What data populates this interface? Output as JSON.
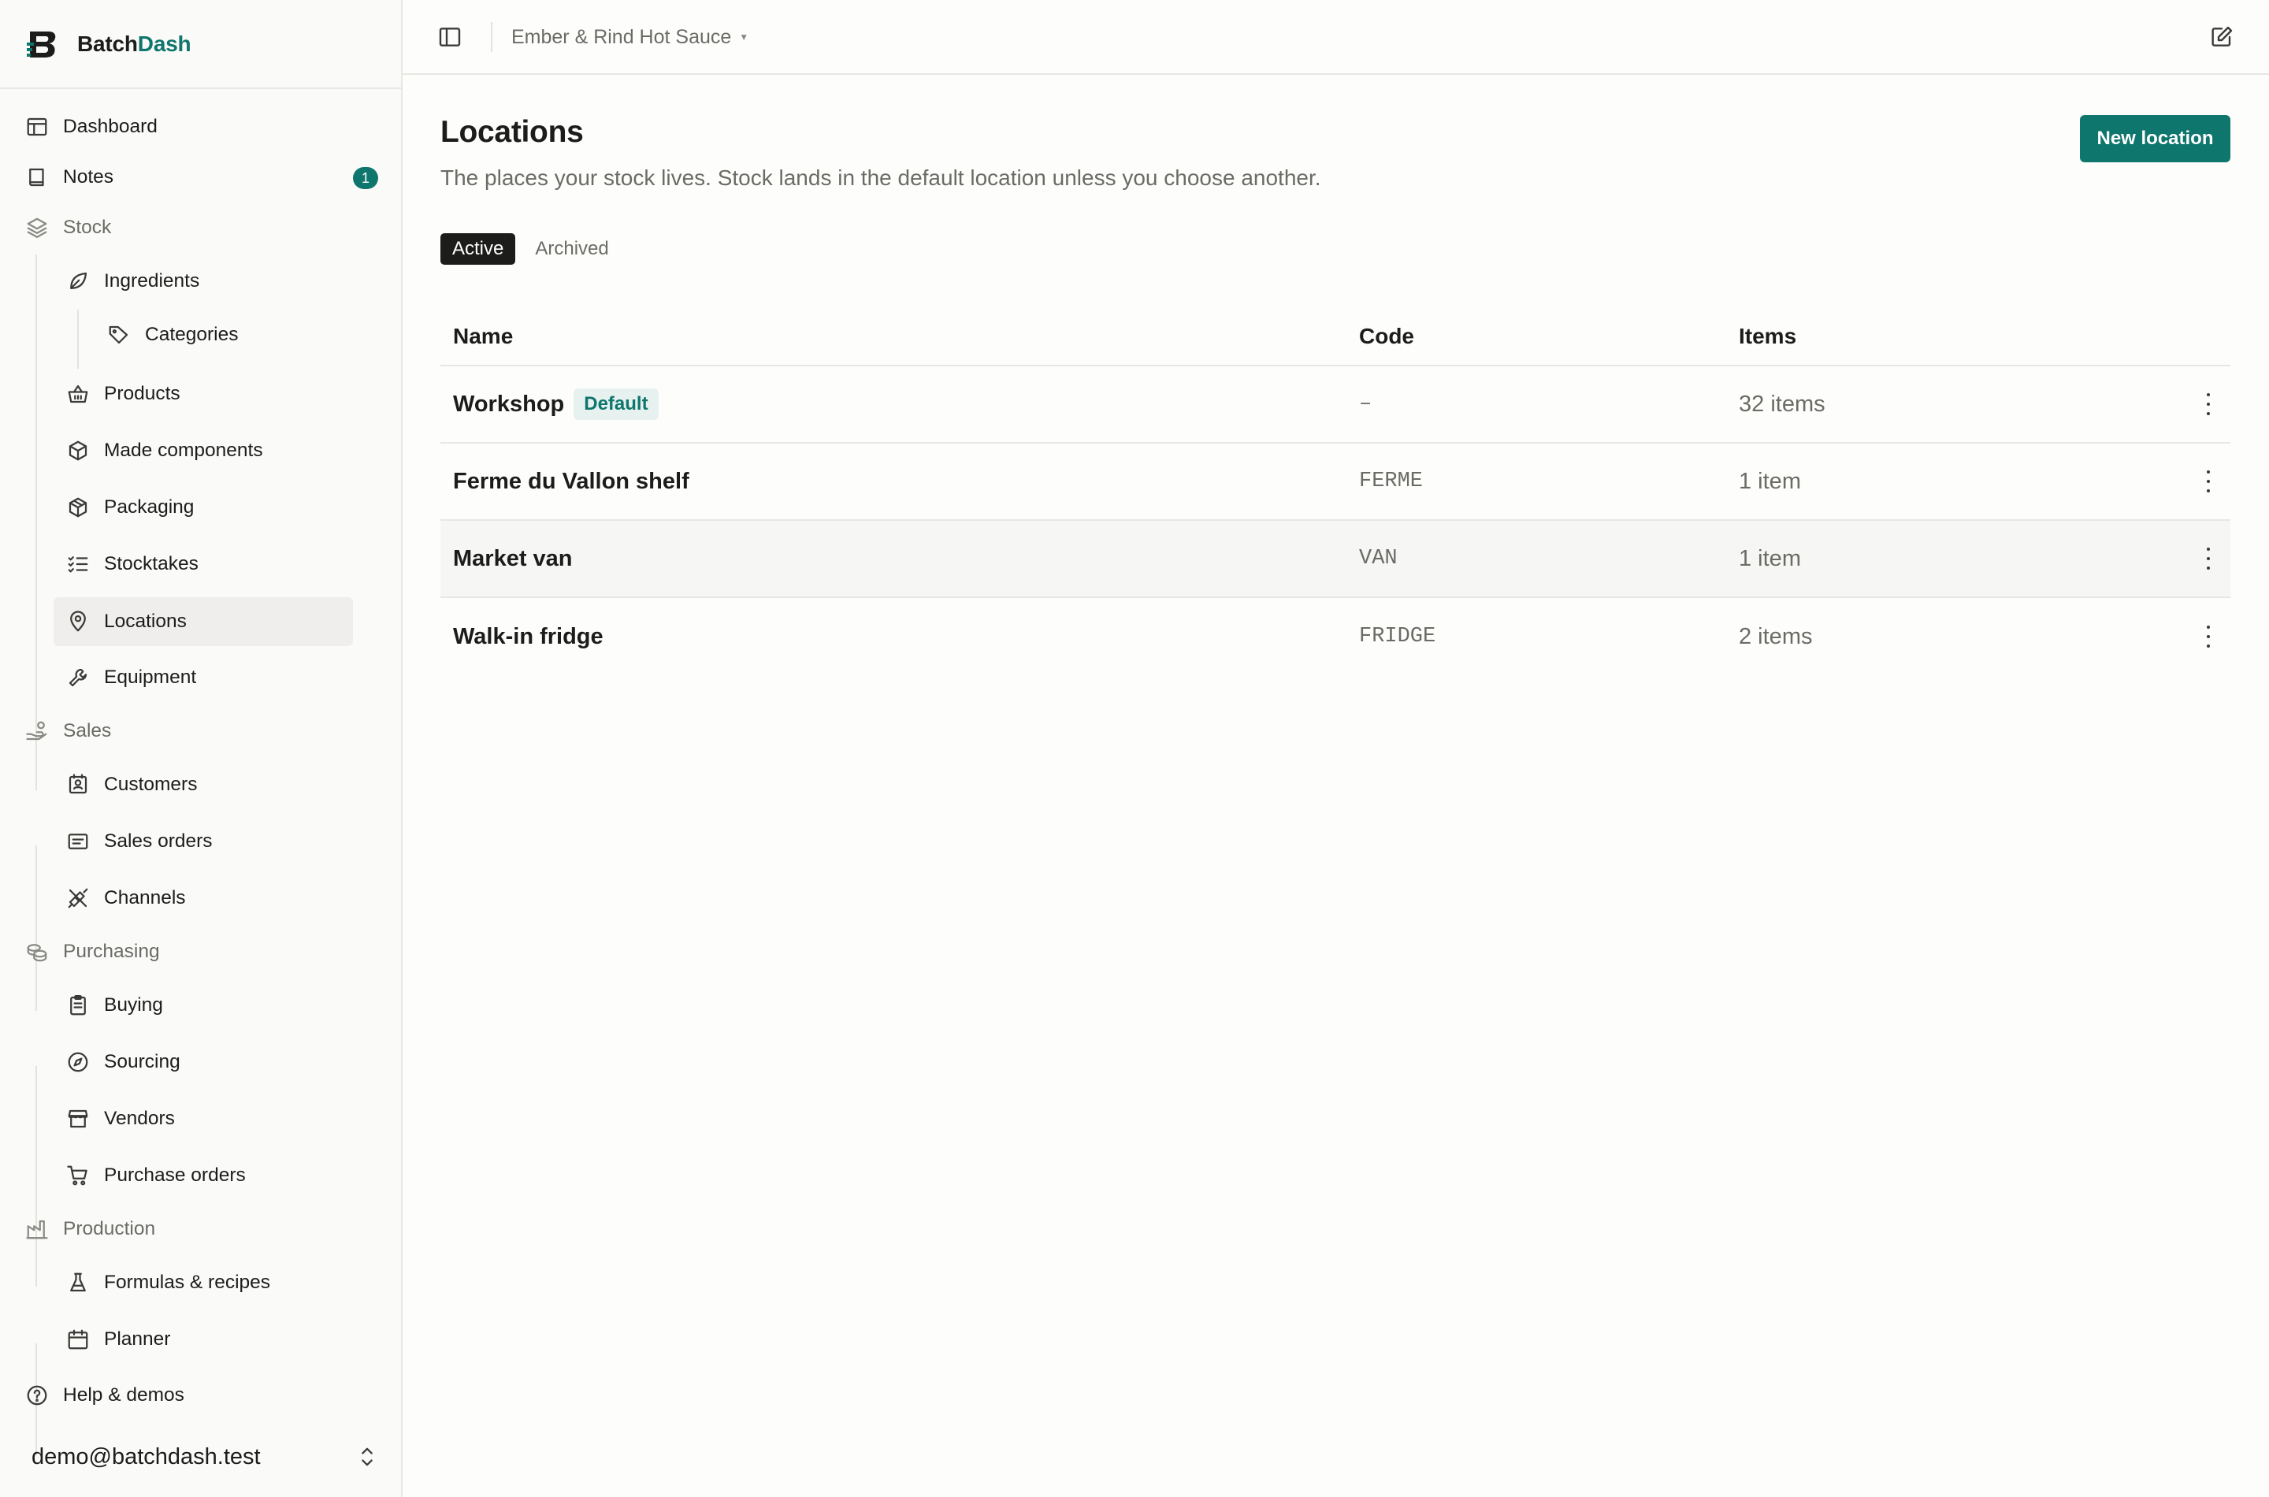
{
  "brand": {
    "name_part1": "Batch",
    "name_part2": "Dash"
  },
  "sidebar": {
    "items": [
      {
        "label": "Dashboard"
      },
      {
        "label": "Notes",
        "badge": "1"
      },
      {
        "label": "Stock"
      },
      {
        "label": "Ingredients"
      },
      {
        "label": "Categories"
      },
      {
        "label": "Products"
      },
      {
        "label": "Made components"
      },
      {
        "label": "Packaging"
      },
      {
        "label": "Stocktakes"
      },
      {
        "label": "Locations"
      },
      {
        "label": "Equipment"
      },
      {
        "label": "Sales"
      },
      {
        "label": "Customers"
      },
      {
        "label": "Sales orders"
      },
      {
        "label": "Channels"
      },
      {
        "label": "Purchasing"
      },
      {
        "label": "Buying"
      },
      {
        "label": "Sourcing"
      },
      {
        "label": "Vendors"
      },
      {
        "label": "Purchase orders"
      },
      {
        "label": "Production"
      },
      {
        "label": "Formulas & recipes"
      },
      {
        "label": "Planner"
      },
      {
        "label": "Help & demos"
      }
    ],
    "active_item": "Locations",
    "user_email": "demo@batchdash.test"
  },
  "topbar": {
    "workspace": "Ember & Rind Hot Sauce"
  },
  "page": {
    "title": "Locations",
    "subtitle": "The places your stock lives. Stock lands in the default location unless you choose another.",
    "new_button": "New location",
    "tabs": [
      {
        "label": "Active"
      },
      {
        "label": "Archived"
      }
    ],
    "active_tab": "Active"
  },
  "table": {
    "headers": {
      "name": "Name",
      "code": "Code",
      "items": "Items"
    },
    "rows": [
      {
        "name": "Workshop",
        "badge": "Default",
        "code": "–",
        "items": "32 items"
      },
      {
        "name": "Ferme du Vallon shelf",
        "code": "FERME",
        "items": "1 item"
      },
      {
        "name": "Market van",
        "code": "VAN",
        "items": "1 item"
      },
      {
        "name": "Walk-in fridge",
        "code": "FRIDGE",
        "items": "2 items"
      }
    ]
  },
  "colors": {
    "accent": "#0f766e",
    "text": "#1c1c1a",
    "muted": "#6b6b66",
    "border": "#e8e7e4"
  }
}
